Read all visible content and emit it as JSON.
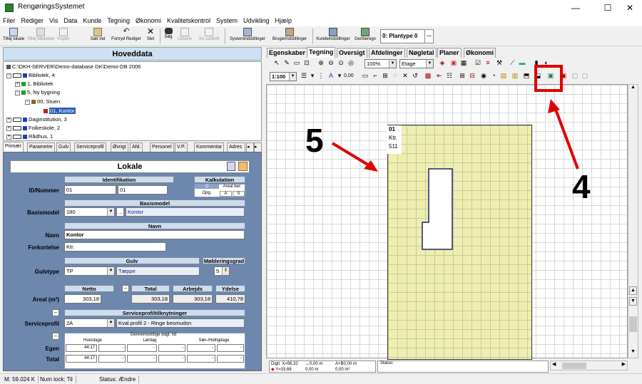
{
  "window": {
    "title": "RengøringsSystemet",
    "minimize": "—",
    "maximize": "☐",
    "close": "✕"
  },
  "menu": [
    "Filer",
    "Rediger",
    "Vis",
    "Data",
    "Kunde",
    "Tegning",
    "Økonomi",
    "Kvalitetskontrol",
    "System",
    "Udvikling",
    "Hjælp"
  ],
  "toolbar": {
    "items": [
      {
        "label": "Tilføj lokale",
        "icon": "add-room-icon",
        "enabled": true
      },
      {
        "label": "Tilføj lokaledel",
        "icon": "add-room-part-icon",
        "enabled": false
      },
      {
        "label": "Kopier",
        "icon": "copy-icon",
        "enabled": false
      },
      {
        "label": "Sæt ind",
        "icon": "paste-icon",
        "enabled": true
      },
      {
        "label": "Fortryd Rediger",
        "icon": "undo-icon",
        "enabled": true
      },
      {
        "label": "Slet",
        "icon": "delete-icon",
        "enabled": true
      },
      {
        "label": "Søg",
        "icon": "binoculars-icon",
        "enabled": true
      },
      {
        "label": "Udskriv",
        "icon": "print-icon",
        "enabled": false
      },
      {
        "label": "Vis udskrift",
        "icon": "print-preview-icon",
        "enabled": false
      },
      {
        "label": "Systemindstillinger",
        "icon": "system-settings-icon",
        "enabled": true
      },
      {
        "label": "Brugerindstillinger",
        "icon": "user-settings-icon",
        "enabled": true
      },
      {
        "label": "Kundeindstillinger",
        "icon": "customer-settings-icon",
        "enabled": true
      },
      {
        "label": "Genberegn",
        "icon": "recalculate-icon",
        "enabled": true
      }
    ],
    "plantype": "0: Plantype 0",
    "plantype_btn": "..."
  },
  "left_panel": {
    "header": "Hoveddata",
    "tree": [
      {
        "label": "C:\\DKH-SERVER\\Demo-database DK\\Demo-DB 2006",
        "level": 0
      },
      {
        "label": "Bibliotek, 4",
        "level": 0,
        "expander": "−"
      },
      {
        "label": "1, Bibliotek",
        "level": 1,
        "expander": "+"
      },
      {
        "label": "5, Ny bygning",
        "level": 1,
        "expander": "−"
      },
      {
        "label": "00, Stuen",
        "level": 2,
        "expander": "−"
      },
      {
        "label": "01, Kontor",
        "level": 3,
        "selected": true
      },
      {
        "label": "Daginstitution, 3",
        "level": 0,
        "expander": "+"
      },
      {
        "label": "Folkeskole, 2",
        "level": 0,
        "expander": "+"
      },
      {
        "label": "Rådhus, 1",
        "level": 0,
        "expander": "+"
      }
    ],
    "tabs": [
      "Primær",
      "Parametre",
      "Gulv",
      "Serviceprofil",
      "Øvrigt",
      "Afd.",
      "Personel",
      "V.P.",
      "Kommentar",
      "Adres"
    ]
  },
  "form": {
    "title": "Lokale",
    "identifikation": {
      "header": "Identifikation",
      "label": "ID/Nummer",
      "id": "01",
      "nummer": "01"
    },
    "kalkulation": {
      "header": "Kalkulation",
      "o": "O",
      "areal_ber": "Areal ber.",
      "opg": "Opg.",
      "a": "A",
      "s": "S"
    },
    "basismodel": {
      "header": "Basismodel",
      "label": "Basismodel",
      "value": "180",
      "name": "Kontor",
      "btn": "..."
    },
    "navn": {
      "header": "Navn",
      "label": "Navn",
      "value": "Kontor",
      "fork_label": "Forkortelse",
      "fork_value": "Ktr."
    },
    "gulv": {
      "header": "Gulv",
      "label": "Gulvtype",
      "value": "TP",
      "name": "Tæppe",
      "mob_header": "Møbleringsgrad",
      "mob_value": "5"
    },
    "areal": {
      "label": "Areal (m²)",
      "netto_h": "Netto",
      "total_h": "Total",
      "arbejds_h": "Arbejds",
      "ydelse_h": "Ydelse",
      "netto": "303,18",
      "total": "303,18",
      "arbejds": "303,18",
      "ydelse": "410,78"
    },
    "service": {
      "header": "Serviceprofiltilknytninger",
      "label": "Serviceprofil",
      "value": "2A",
      "name": "Kval.profil 2 - Ringe besmudsn"
    },
    "rengoring": {
      "header": "Gennemsnitlige dagl. tid",
      "hverdage": "Hverdage",
      "lordag": "Lørdag",
      "son": "Søn-/Helligdage",
      "egen_label": "Egen",
      "total_label": "Total",
      "egen_hverdage": "44:17",
      "total_hverdage": "44:17",
      "dash": "-"
    }
  },
  "right_panel": {
    "tabs": [
      "Egenskaber",
      "Tegning",
      "Oversigt",
      "Afdelinger",
      "Nøgletal",
      "Planer",
      "Økonomi"
    ],
    "zoom": "100%",
    "level": "Etage",
    "scale": "1:100",
    "value": "0,00",
    "room": {
      "number": "01",
      "abbr": "Ktr.",
      "code": "511"
    },
    "coords": {
      "x_label": "Digit. X=",
      "x": "56,32",
      "y_label": "Y=",
      "y": "33,68",
      "a_label": "↔",
      "a": "0,00 m",
      "b_label": "A+B",
      "b": "0,00 m",
      "c": "0,00 m",
      "d": "0,00 m²"
    },
    "status_label": "Status:"
  },
  "statusbar": {
    "memory": "M: 59.024 K",
    "numlock": "Num lock: Til",
    "status": "Status: Ændre"
  },
  "annotations": {
    "five": "5",
    "four": "4"
  }
}
